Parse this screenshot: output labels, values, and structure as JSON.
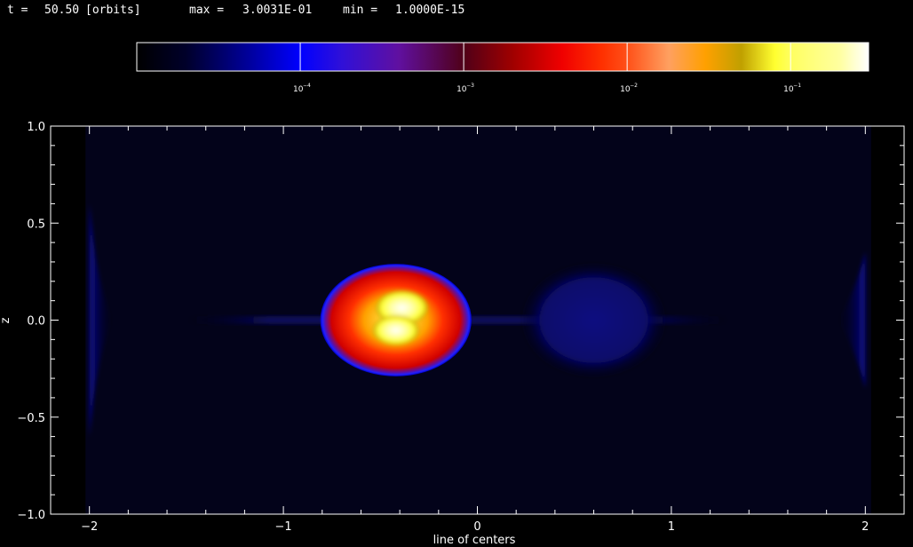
{
  "header": {
    "time_label": "t =",
    "time_value": "50.50",
    "time_unit": "[orbits]",
    "max_label": "max =",
    "max_value": "3.0031E-01",
    "min_label": "min =",
    "min_value": "1.0000E-15"
  },
  "colorbar": {
    "scale": "log",
    "range": [
      1e-05,
      0.3
    ],
    "stops": [
      {
        "value": 1e-05,
        "color": "#000000"
      },
      {
        "value": 2e-05,
        "color": "#00002a"
      },
      {
        "value": 5e-05,
        "color": "#0000a0"
      },
      {
        "value": 0.0001,
        "color": "#0000ff"
      },
      {
        "value": 0.00018,
        "color": "#3010d8"
      },
      {
        "value": 0.0004,
        "color": "#6010a0"
      },
      {
        "value": 0.001,
        "color": "#500018"
      },
      {
        "value": 0.002,
        "color": "#a00000"
      },
      {
        "value": 0.004,
        "color": "#f00000"
      },
      {
        "value": 0.007,
        "color": "#ff3000"
      },
      {
        "value": 0.01,
        "color": "#ff5018"
      },
      {
        "value": 0.018,
        "color": "#ffa060"
      },
      {
        "value": 0.03,
        "color": "#ffa000"
      },
      {
        "value": 0.05,
        "color": "#c0a000"
      },
      {
        "value": 0.08,
        "color": "#ffff30"
      },
      {
        "value": 0.1,
        "color": "#ffff60"
      },
      {
        "value": 0.2,
        "color": "#ffffa0"
      },
      {
        "value": 0.3,
        "color": "#ffffff"
      }
    ],
    "ticks": [
      {
        "value": 0.0001,
        "base": "10",
        "exponent": "−4"
      },
      {
        "value": 0.001,
        "base": "10",
        "exponent": "−3"
      },
      {
        "value": 0.01,
        "base": "10",
        "exponent": "−2"
      },
      {
        "value": 0.1,
        "base": "10",
        "exponent": "−1"
      }
    ]
  },
  "chart_data": {
    "type": "heatmap",
    "title": "",
    "xlabel": "line of centers",
    "ylabel": "z",
    "xlim": [
      -2.2,
      2.2
    ],
    "ylim": [
      -1.0,
      1.0
    ],
    "x_ticks": [
      -2,
      -1,
      0,
      1,
      2
    ],
    "x_tick_labels": [
      "−2",
      "−1",
      "0",
      "1",
      "2"
    ],
    "y_ticks": [
      -1.0,
      -0.5,
      0.0,
      0.5,
      1.0
    ],
    "y_tick_labels": [
      "−1.0",
      "−0.5",
      "0.0",
      "0.5",
      "1.0"
    ],
    "grid": false,
    "background_color": "#03031a",
    "features": [
      {
        "name": "primary-star",
        "center": [
          -0.42,
          0.0
        ],
        "radius": [
          0.39,
          0.29
        ],
        "peak_value": 0.3
      },
      {
        "name": "secondary-lobe",
        "center": [
          0.6,
          0.0
        ],
        "radius": [
          0.38,
          0.3
        ],
        "peak_value": 8e-05
      },
      {
        "name": "disk-plane",
        "x_range": [
          -1.5,
          1.3
        ],
        "half_thickness": 0.02,
        "peak_value": 6e-05
      },
      {
        "name": "left-edge-flare",
        "x": -2.0,
        "half_height": 0.6,
        "peak_value": 7e-05
      },
      {
        "name": "right-edge-flare",
        "x": 2.0,
        "half_height": 0.35,
        "peak_value": 7e-05
      }
    ]
  }
}
